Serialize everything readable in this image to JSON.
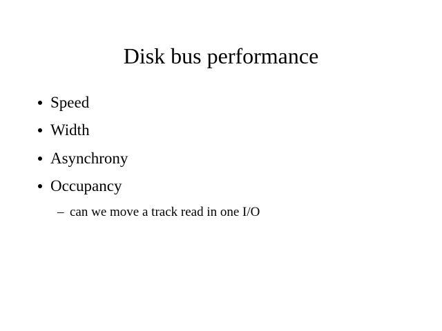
{
  "slide": {
    "title": "Disk bus performance",
    "bullets": [
      {
        "text": "Speed"
      },
      {
        "text": "Width"
      },
      {
        "text": "Asynchrony"
      },
      {
        "text": "Occupancy"
      }
    ],
    "sub_bullets": [
      {
        "marker": "–",
        "text": "can we move a track read in one I/O"
      }
    ]
  }
}
